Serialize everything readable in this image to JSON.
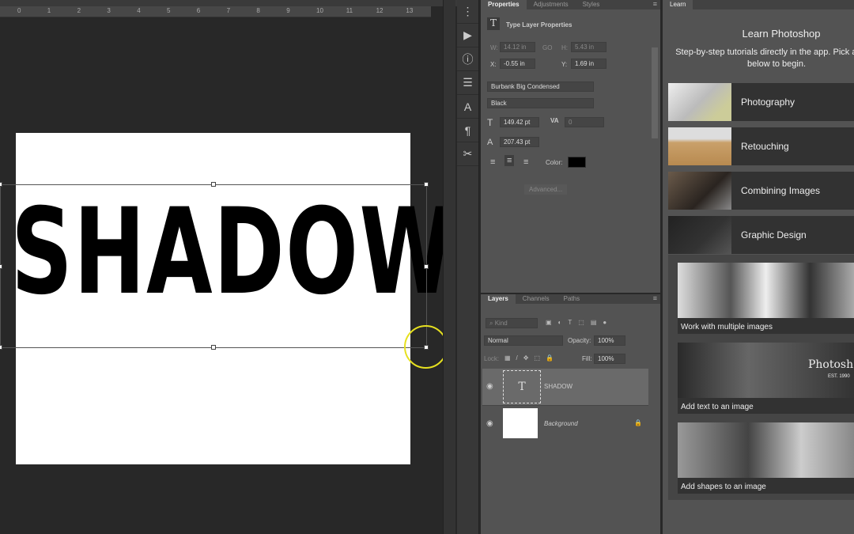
{
  "ruler": {
    "ticks": [
      "0",
      "1",
      "2",
      "3",
      "4",
      "5",
      "6",
      "7",
      "8",
      "9",
      "10",
      "11",
      "12",
      "13"
    ]
  },
  "canvas": {
    "text": "SHADOW"
  },
  "tools": [
    {
      "icon": "history-icon",
      "glyph": "⋮"
    },
    {
      "icon": "play-icon",
      "glyph": "▶"
    },
    {
      "icon": "info-icon",
      "glyph": "ⓘ"
    },
    {
      "icon": "adjustments-icon",
      "glyph": "☰"
    },
    {
      "icon": "character-icon",
      "glyph": "A"
    },
    {
      "icon": "paragraph-icon",
      "glyph": "¶"
    },
    {
      "icon": "tools-icon",
      "glyph": "✂"
    }
  ],
  "properties": {
    "tabs": [
      "Properties",
      "Adjustments",
      "Styles"
    ],
    "title": "Type Layer Properties",
    "w_label": "W:",
    "w": "14.12 in",
    "link": "GO",
    "h_label": "H:",
    "h": "5.43 in",
    "x_label": "X:",
    "x": "-0.55 in",
    "y_label": "Y:",
    "y": "1.69 in",
    "font": "Burbank Big Condensed",
    "style": "Black",
    "size": "149.42 pt",
    "tracking": "0",
    "leading": "207.43 pt",
    "color_label": "Color:",
    "text_color": "#000000",
    "advanced": "Advanced..."
  },
  "layers": {
    "tabs": [
      "Layers",
      "Channels",
      "Paths"
    ],
    "kind": "Kind",
    "blend": "Normal",
    "opacity_label": "Opacity:",
    "opacity": "100%",
    "lock_label": "Lock:",
    "fill_label": "Fill:",
    "fill": "100%",
    "items": [
      {
        "name": "SHADOW",
        "type": "text",
        "selected": true
      },
      {
        "name": "Background",
        "type": "image",
        "locked": true
      }
    ]
  },
  "learn": {
    "tab": "Learn",
    "title": "Learn Photoshop",
    "subtitle": "Step-by-step tutorials directly in the app. Pick a topic below to begin.",
    "categories": [
      "Photography",
      "Retouching",
      "Combining Images",
      "Graphic Design"
    ],
    "tutorials": [
      "Work with multiple images",
      "Add text to an image",
      "Add shapes to an image"
    ],
    "thumb_text": "Photosh",
    "thumb_sub": "EST. 1990"
  }
}
